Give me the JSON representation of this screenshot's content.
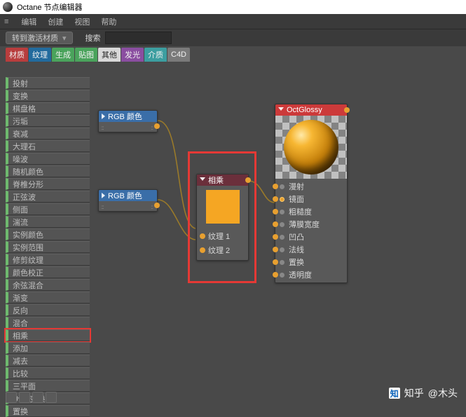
{
  "window": {
    "title": "Octane 节点编辑器"
  },
  "menu": {
    "hamburger": "≡",
    "edit": "编辑",
    "create": "创建",
    "view": "视图",
    "help": "帮助"
  },
  "toolbar": {
    "activate_label": "转到激活材质",
    "search_label": "搜索",
    "search_value": ""
  },
  "tabs": [
    {
      "label": "材质",
      "color": "#b83d3d"
    },
    {
      "label": "纹理",
      "color": "#226b9e"
    },
    {
      "label": "生成",
      "color": "#4aa35c"
    },
    {
      "label": "贴图",
      "color": "#4aa35c"
    },
    {
      "label": "其他",
      "color": "#d8d8d8"
    },
    {
      "label": "发光",
      "color": "#8a4ea0"
    },
    {
      "label": "介质",
      "color": "#3c9ea0"
    },
    {
      "label": "C4D",
      "color": "#7a7a7a"
    }
  ],
  "sidebar": {
    "items": [
      "投射",
      "变换",
      "棋盘格",
      "污垢",
      "衰减",
      "大理石",
      "噪波",
      "随机颜色",
      "脊椎分形",
      "正弦波",
      "侧面",
      "湍流",
      "实例颜色",
      "实例范围",
      "修剪纹理",
      "颜色校正",
      "余弦混合",
      "渐变",
      "反向",
      "混合",
      "相乘",
      "添加",
      "减去",
      "比较",
      "三平面",
      "Uvw 变换",
      "置换"
    ],
    "highlight_index": 20
  },
  "nodes": {
    "rgb1": {
      "title": "RGB 颜色"
    },
    "rgb2": {
      "title": "RGB 颜色"
    },
    "multiply": {
      "title": "相乘",
      "inputs": [
        "纹理 1",
        "纹理 2"
      ]
    },
    "glossy": {
      "title": "OctGlossy",
      "params": [
        "漫射",
        "镜面",
        "粗糙度",
        "薄膜宽度",
        "凹凸",
        "法线",
        "置换",
        "透明度"
      ],
      "active_param_index": 1
    }
  },
  "watermark": {
    "brand": "知",
    "label": "知乎",
    "author": "@木头"
  }
}
